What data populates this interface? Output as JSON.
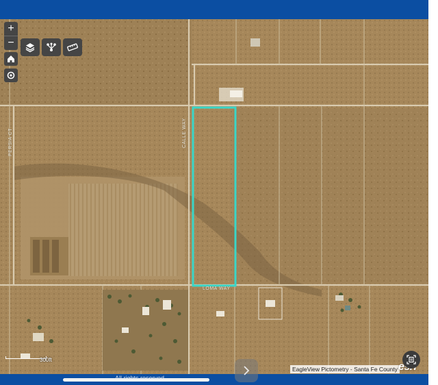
{
  "map": {
    "zoom_in_label": "+",
    "zoom_out_label": "−",
    "attribution": "EagleView Pictometry - Santa Fe County",
    "logo_text": "esri",
    "scale_label": "300ft",
    "rights_text": "All rights reserved",
    "road_labels": {
      "west_road": "PERSIA CT",
      "middle_road": "CALLE WAY",
      "south_road": "LOMA WAY"
    },
    "parcel_highlight_color": "#39d6c8",
    "icons": {
      "home": "home-icon",
      "locate": "locate-icon",
      "basemap": "layers-icon",
      "share": "share-icon",
      "measure": "measure-icon",
      "scan": "scan-document-icon",
      "next": "chevron-right-icon"
    }
  }
}
